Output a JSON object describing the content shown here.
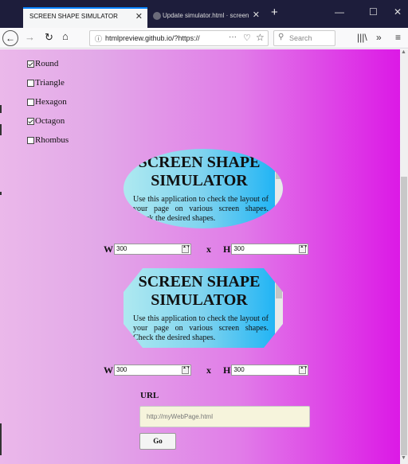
{
  "browser": {
    "active_tab": {
      "title": "SCREEN SHAPE SIMULATOR",
      "close": "✕"
    },
    "inactive_tab": {
      "title": "Update simulator.html · screen",
      "close": "✕"
    },
    "new_tab": "+",
    "window_controls": {
      "minimize": "—",
      "maximize": "☐",
      "close": "✕"
    },
    "toolbar": {
      "back": "←",
      "forward": "→",
      "reload": "↻",
      "home": "⌂",
      "url": "htmlpreview.github.io/?https://",
      "info_icon": "ⓘ",
      "more_icon": "···",
      "pocket_icon": "♡",
      "star_icon": "☆",
      "search_placeholder": "Search",
      "search_icon": "⚲",
      "library_icon": "|||\\",
      "overflow_icon": "»",
      "menu_icon": "≡"
    }
  },
  "page": {
    "shape_options": [
      {
        "label": "Round",
        "checked": true
      },
      {
        "label": "Triangle",
        "checked": false
      },
      {
        "label": "Hexagon",
        "checked": false
      },
      {
        "label": "Octagon",
        "checked": true
      },
      {
        "label": "Rhombus",
        "checked": false
      }
    ],
    "preview_round": {
      "title": "SCREEN SHAPE SIMULATOR",
      "description": "Use this application to check the layout of your page on various screen shapes. Check the desired shapes."
    },
    "preview_octagon": {
      "title": "SCREEN SHAPE SIMULATOR",
      "description": "Use this application to check the layout of your page on various screen shapes. Check the desired shapes."
    },
    "dims_round": {
      "w_label": "W",
      "w_value": "300",
      "x_label": "x",
      "h_label": "H",
      "h_value": "300"
    },
    "dims_octagon": {
      "w_label": "W",
      "w_value": "300",
      "x_label": "x",
      "h_label": "H",
      "h_value": "300"
    },
    "spin_glyph": "▲▼",
    "url_label": "URL",
    "url_placeholder": "http://myWebPage.html",
    "go_label": "Go"
  },
  "colors": {
    "background_left": "#ebb8ea",
    "background_right": "#dc19e6",
    "preview_left": "#aee9f0",
    "preview_right": "#17b1f5",
    "url_input_bg": "#f6f4dc"
  }
}
